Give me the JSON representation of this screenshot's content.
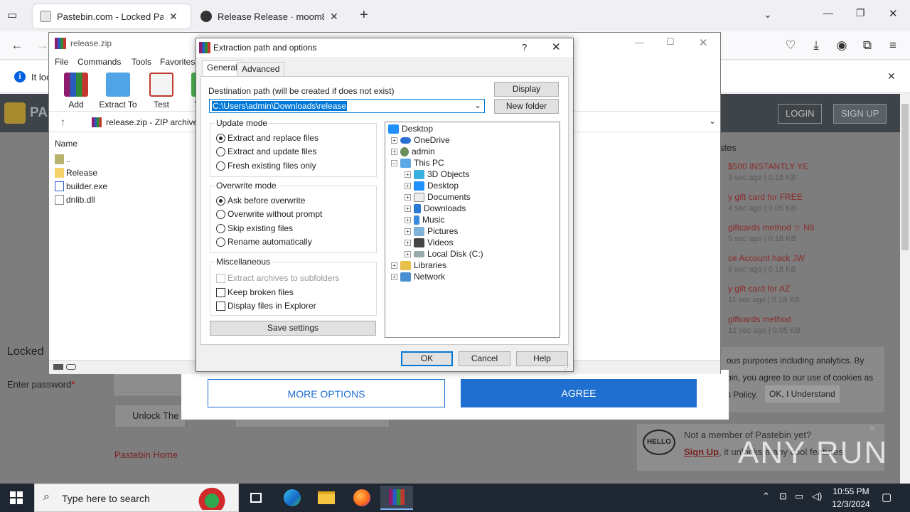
{
  "browser": {
    "tabs": [
      {
        "label": "Pastebin.com - Locked Paste",
        "active": true
      },
      {
        "label": "Release Release · moom825/Di",
        "active": false
      }
    ],
    "info_text": "It loc"
  },
  "pastebin": {
    "logo": "PA",
    "login": "LOGIN",
    "signup": "SIGN UP",
    "section_title": "stes",
    "recent": [
      {
        "title": "$500 INSTANTLY YE",
        "meta": "3 sec ago | 0.18 KB"
      },
      {
        "title": "y gift card for FREE",
        "meta": "4 sec ago | 0.05 KB"
      },
      {
        "title": "giftcards method ☆ N8",
        "meta": "5 sec ago | 0.18 KB"
      },
      {
        "title": "ce Account hack JW",
        "meta": "8 sec ago | 0.18 KB"
      },
      {
        "title": "y gift card for AZ",
        "meta": "11 sec ago | 0.18 KB"
      },
      {
        "title": "giftcards method",
        "meta": "12 sec ago | 0.05 KB"
      }
    ],
    "locked_title": "Locked",
    "password_label": "Enter password",
    "unlock_button": "Unlock The",
    "home_link": "Pastebin Home",
    "cookie_text_1": "ous purposes including analytics. By",
    "cookie_text_2": "bin, you agree to our use of cookies as",
    "cookie_text_3": "s Policy.",
    "cookie_ok": "OK, I Understand",
    "member_text": "Not a member of Pastebin yet?",
    "signup_link": "Sign Up",
    "member_rest": ", it unlocks many cool features!",
    "more_options": "MORE OPTIONS",
    "agree": "AGREE"
  },
  "winrar": {
    "title": "release.zip",
    "menu": [
      "File",
      "Commands",
      "Tools",
      "Favorites"
    ],
    "tools": [
      "Add",
      "Extract To",
      "Test",
      "Vi"
    ],
    "address": "release.zip - ZIP archive,",
    "column_name": "Name",
    "files": [
      "..",
      "Release",
      "builder.exe",
      "dnlib.dll"
    ]
  },
  "dialog": {
    "title": "Extraction path and options",
    "help_glyph": "?",
    "tabs": [
      "General",
      "Advanced"
    ],
    "dest_label": "Destination path (will be created if does not exist)",
    "dest_value": "C:\\Users\\admin\\Downloads\\release",
    "display_btn": "Display",
    "new_folder_btn": "New folder",
    "update_mode": {
      "title": "Update mode",
      "options": [
        "Extract and replace files",
        "Extract and update files",
        "Fresh existing files only"
      ],
      "selected": 0
    },
    "overwrite_mode": {
      "title": "Overwrite mode",
      "options": [
        "Ask before overwrite",
        "Overwrite without prompt",
        "Skip existing files",
        "Rename automatically"
      ],
      "selected": 0
    },
    "misc": {
      "title": "Miscellaneous",
      "options": [
        "Extract archives to subfolders",
        "Keep broken files",
        "Display files in Explorer"
      ]
    },
    "save_settings": "Save settings",
    "tree": [
      "Desktop",
      "OneDrive",
      "admin",
      "This PC",
      "3D Objects",
      "Desktop",
      "Documents",
      "Downloads",
      "Music",
      "Pictures",
      "Videos",
      "Local Disk (C:)",
      "Libraries",
      "Network"
    ],
    "ok": "OK",
    "cancel": "Cancel",
    "help": "Help"
  },
  "taskbar": {
    "search_placeholder": "Type here to search",
    "time": "10:55 PM",
    "date": "12/3/2024"
  },
  "watermark": "ANY RUN",
  "colors": {
    "accent": "#0078d7",
    "agree_blue": "#1e6fd0",
    "pastebin_header": "#3f4448",
    "link_red": "#8b2b2b"
  }
}
